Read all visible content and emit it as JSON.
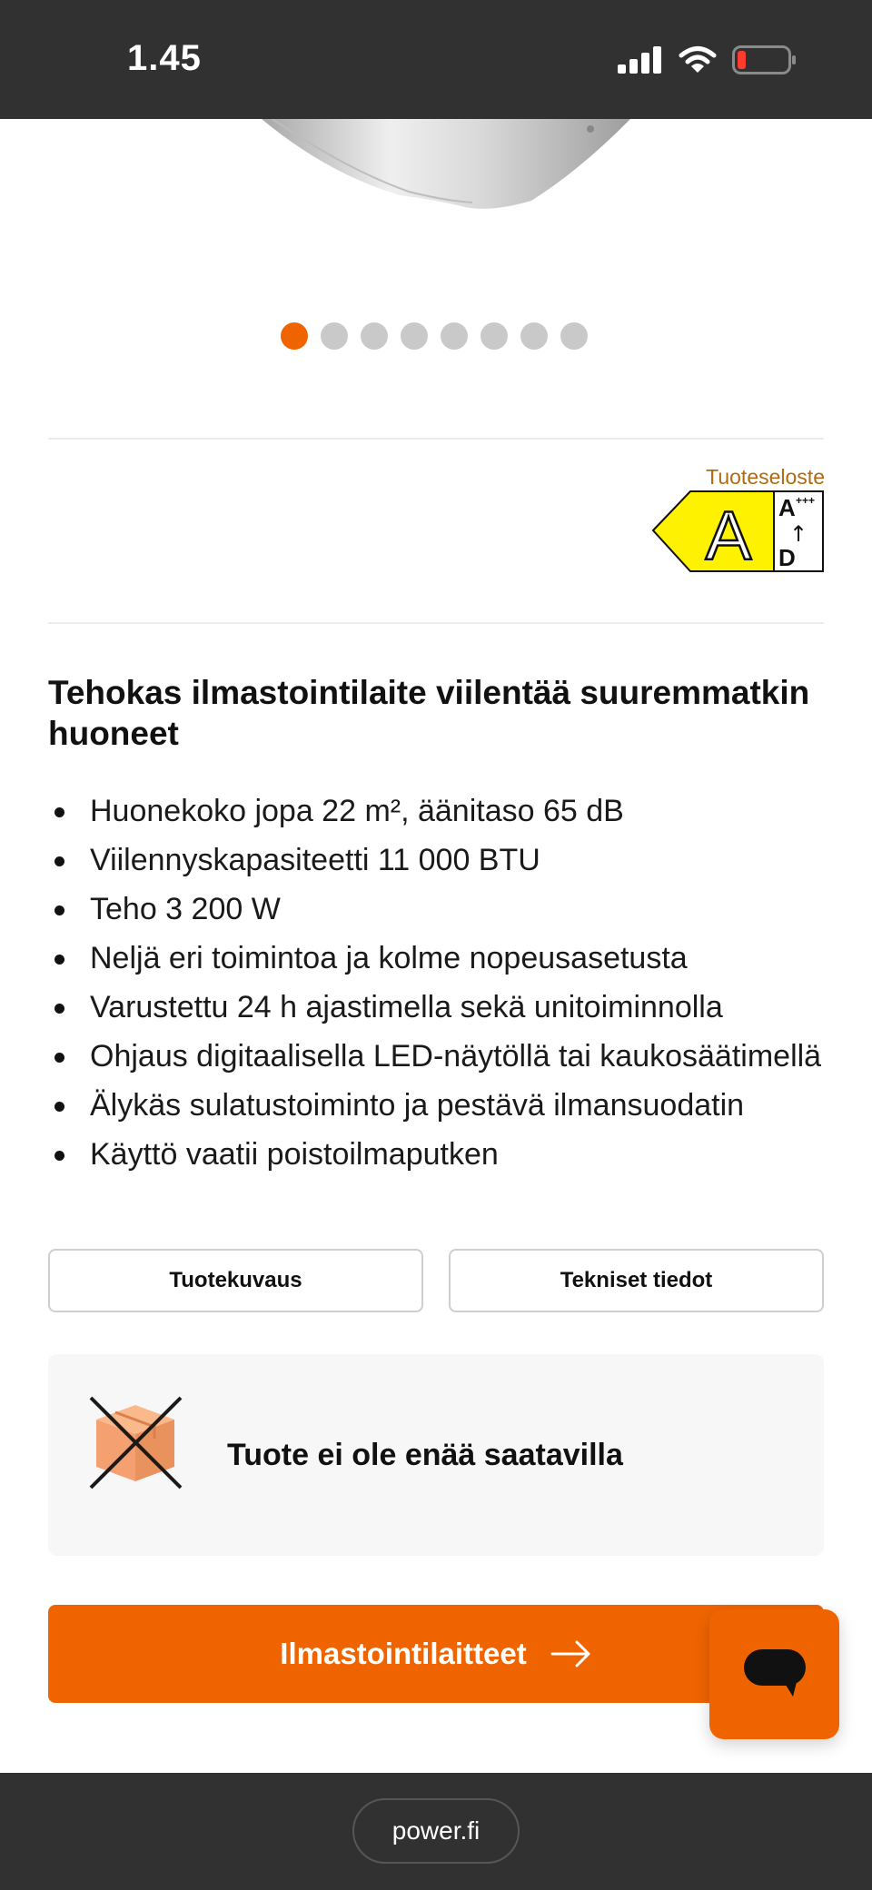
{
  "status_bar": {
    "time": "1.45"
  },
  "carousel": {
    "dot_count": 8,
    "active_index": 0
  },
  "energy_label": {
    "link_text": "Tuoteseloste",
    "grade": "A",
    "scale_top": "A",
    "scale_top_suffix": "+++",
    "scale_arrow": "↑",
    "scale_bottom": "D"
  },
  "product": {
    "headline": "Tehokas ilmastointilaite viilentää suuremmatkin huoneet",
    "bullets": [
      "Huonekoko jopa 22 m², äänitaso 65 dB",
      "Viilennyskapasiteetti 11 000 BTU",
      "Teho 3 200 W",
      "Neljä eri toimintoa ja kolme nopeusasetusta",
      "Varustettu 24 h ajastimella sekä unitoiminnolla",
      "Ohjaus digitaalisella LED-näytöllä tai kaukosäätimellä",
      "Älykäs sulatustoiminto ja pestävä ilmansuodatin",
      "Käyttö vaatii poistoilmaputken"
    ]
  },
  "tabs": {
    "description": "Tuotekuvaus",
    "specs": "Tekniset tiedot"
  },
  "availability": {
    "text": "Tuote ei ole enää saatavilla"
  },
  "cta": {
    "label": "Ilmastointilaitteet"
  },
  "browser": {
    "url": "power.fi"
  },
  "colors": {
    "accent": "#f06400",
    "bar": "#313131",
    "energy_yellow": "#fff200"
  }
}
